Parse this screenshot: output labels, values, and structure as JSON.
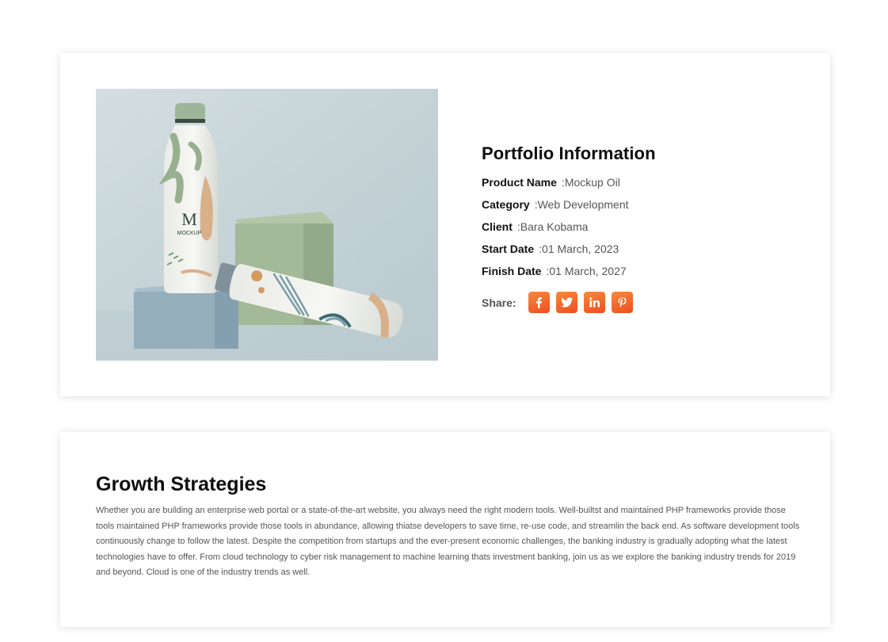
{
  "portfolio": {
    "title": "Portfolio Information",
    "rows": [
      {
        "label": "Product Name",
        "value": "Mockup Oil"
      },
      {
        "label": "Category",
        "value": "Web Development"
      },
      {
        "label": "Client",
        "value": "Bara Kobama"
      },
      {
        "label": "Start Date",
        "value": "01 March, 2023"
      },
      {
        "label": "Finish Date",
        "value": "01 March, 2027"
      }
    ],
    "separator": ":",
    "share_label": "Share:",
    "share_icons": [
      "facebook-icon",
      "twitter-icon",
      "linkedin-icon",
      "pinterest-icon"
    ],
    "image_text": {
      "brand_letter": "M",
      "brand_word": "MOCKUP"
    }
  },
  "growth": {
    "title": "Growth Strategies",
    "body": "Whether you are building an enterprise web portal or a state-of-the-art website, you always need the right modern tools. Well-builtst and maintained PHP frameworks provide those tools maintained PHP frameworks provide those tools in abundance, allowing thiatse developers to save time, re-use code, and streamlin the back end. As software development tools continuously change to follow the latest. Despite the competition from startups and the ever-present economic challenges, the banking industry is gradually adopting what the latest technologies have to offer. From cloud technology to cyber risk management to machine learning thats investment banking, join us as we explore the banking industry trends for 2019 and beyond. Cloud is one of the industry trends as well."
  },
  "colors": {
    "accent_start": "#f58a3e",
    "accent_end": "#ee4d21"
  }
}
